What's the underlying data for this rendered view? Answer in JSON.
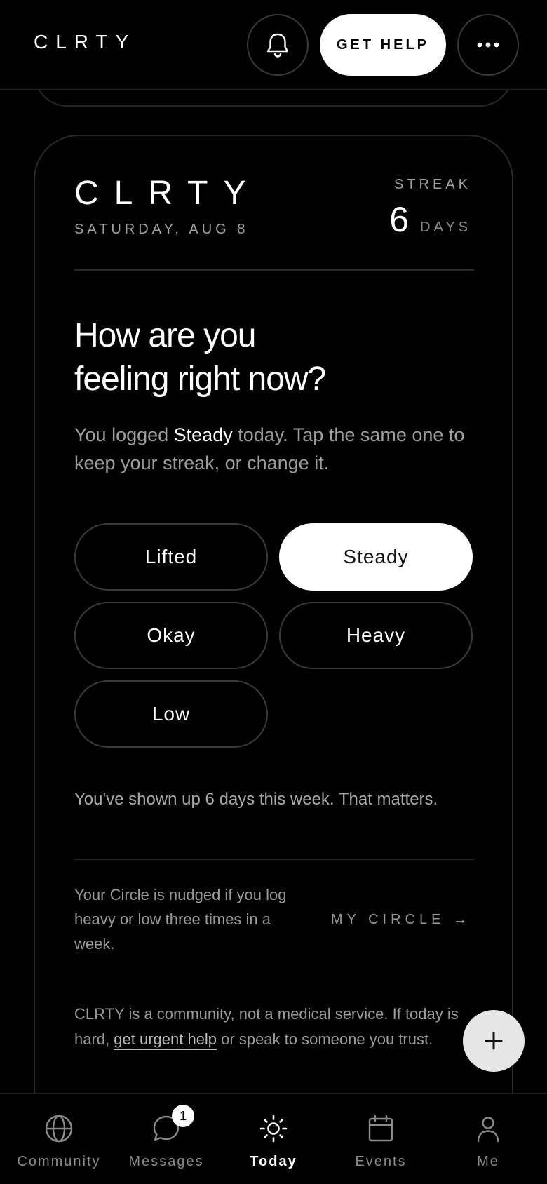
{
  "header": {
    "brand": "CLRTY",
    "help_label": "GET HELP",
    "bell_icon": "bell-icon",
    "more_icon": "more-horizontal-icon"
  },
  "card": {
    "brand": "CLRTY",
    "date": "SATURDAY, AUG 8",
    "streak_label": "STREAK",
    "streak_value": "6",
    "streak_unit": "DAYS",
    "question_line1": "How are you",
    "question_line2": "feeling right now?",
    "sub_prefix": "You logged ",
    "sub_mood": "Steady",
    "sub_suffix": " today. Tap the same one to keep your streak, or change it.",
    "moods": [
      {
        "label": "Lifted",
        "selected": false
      },
      {
        "label": "Steady",
        "selected": true
      },
      {
        "label": "Okay",
        "selected": false
      },
      {
        "label": "Heavy",
        "selected": false
      },
      {
        "label": "Low",
        "selected": false
      }
    ],
    "encouragement": "You've shown up 6 days this week. That matters.",
    "circle_note": "Your Circle is nudged if you log heavy or low three times in a week.",
    "circle_link": "MY CIRCLE →",
    "disclaimer_prefix": "CLRTY is a community, not a medical service. If today is hard, ",
    "disclaimer_link": "get urgent help",
    "disclaimer_suffix": " or speak to someone you trust."
  },
  "fab": {
    "icon": "plus-icon"
  },
  "nav": {
    "items": [
      {
        "label": "Community",
        "icon": "globe-icon",
        "active": false
      },
      {
        "label": "Messages",
        "icon": "chat-bubble-icon",
        "active": false,
        "badge": "1"
      },
      {
        "label": "Today",
        "icon": "sun-icon",
        "active": true
      },
      {
        "label": "Events",
        "icon": "calendar-icon",
        "active": false
      },
      {
        "label": "Me",
        "icon": "person-icon",
        "active": false
      }
    ]
  },
  "colors": {
    "background": "#000000",
    "primary": "#ffffff",
    "muted": "#9a9a9a",
    "border": "#2a2a2a",
    "fab": "#e6e6e6"
  }
}
